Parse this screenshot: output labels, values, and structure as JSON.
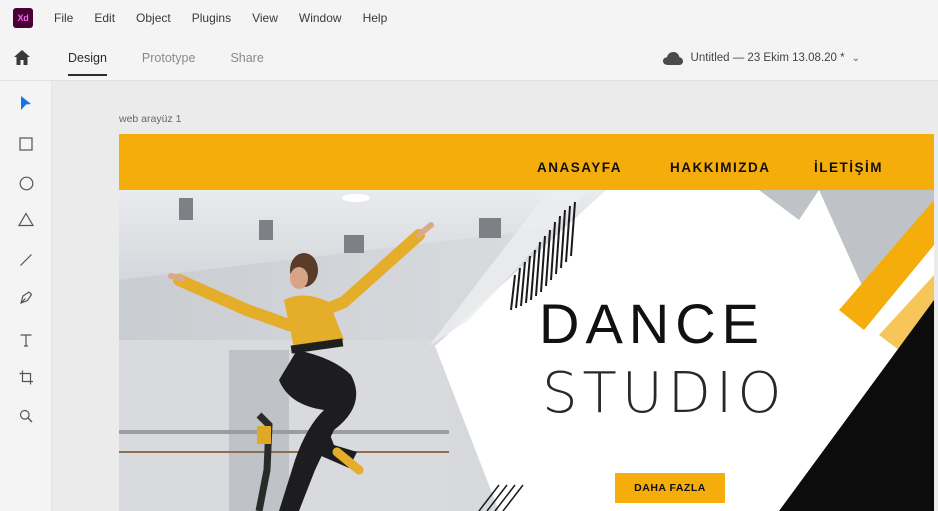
{
  "app": {
    "logo_text": "Xd"
  },
  "menu": [
    "File",
    "Edit",
    "Object",
    "Plugins",
    "View",
    "Window",
    "Help"
  ],
  "tabs": [
    {
      "label": "Design",
      "active": true
    },
    {
      "label": "Prototype",
      "active": false
    },
    {
      "label": "Share",
      "active": false
    }
  ],
  "document": {
    "title": "Untitled — 23 Ekim 13.08.20 *"
  },
  "tools": [
    "select-tool-icon",
    "rectangle-tool-icon",
    "ellipse-tool-icon",
    "polygon-tool-icon",
    "line-tool-icon",
    "pen-tool-icon",
    "text-tool-icon",
    "artboard-tool-icon",
    "zoom-tool-icon"
  ],
  "canvas": {
    "artboard_label": "web arayüz 1",
    "nav": [
      "ANASAYFA",
      "HAKKIMIZDA",
      "İLETİŞİM"
    ],
    "headline_1": "DANCE",
    "headline_2": "STUDIO",
    "button_label": "DAHA FAZLA"
  },
  "colors": {
    "accent": "#f5ad0c",
    "select_tool": "#1473e6",
    "xd_logo_bg": "#470137",
    "xd_logo_fg": "#ff61f6"
  }
}
